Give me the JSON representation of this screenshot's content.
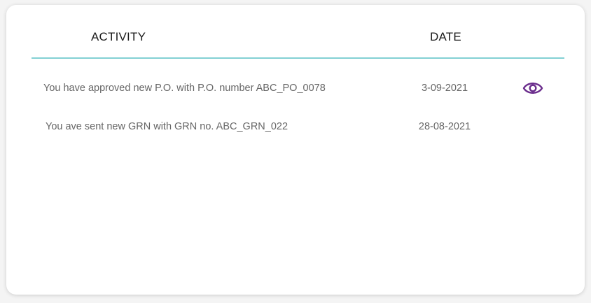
{
  "table": {
    "headers": {
      "activity": "ACTIVITY",
      "date": "DATE"
    },
    "rows": [
      {
        "activity": "You have approved new P.O. with P.O. number ABC_PO_0078",
        "date": "3-09-2021",
        "action_icon": "eye-icon"
      },
      {
        "activity": "You ave sent new GRN with GRN no. ABC_GRN_022",
        "date": "28-08-2021"
      }
    ]
  },
  "colors": {
    "header_divider": "#83d0d4",
    "eye_icon": "#6a2c8c",
    "row_text": "#666666",
    "header_text": "#1c1c1c"
  }
}
